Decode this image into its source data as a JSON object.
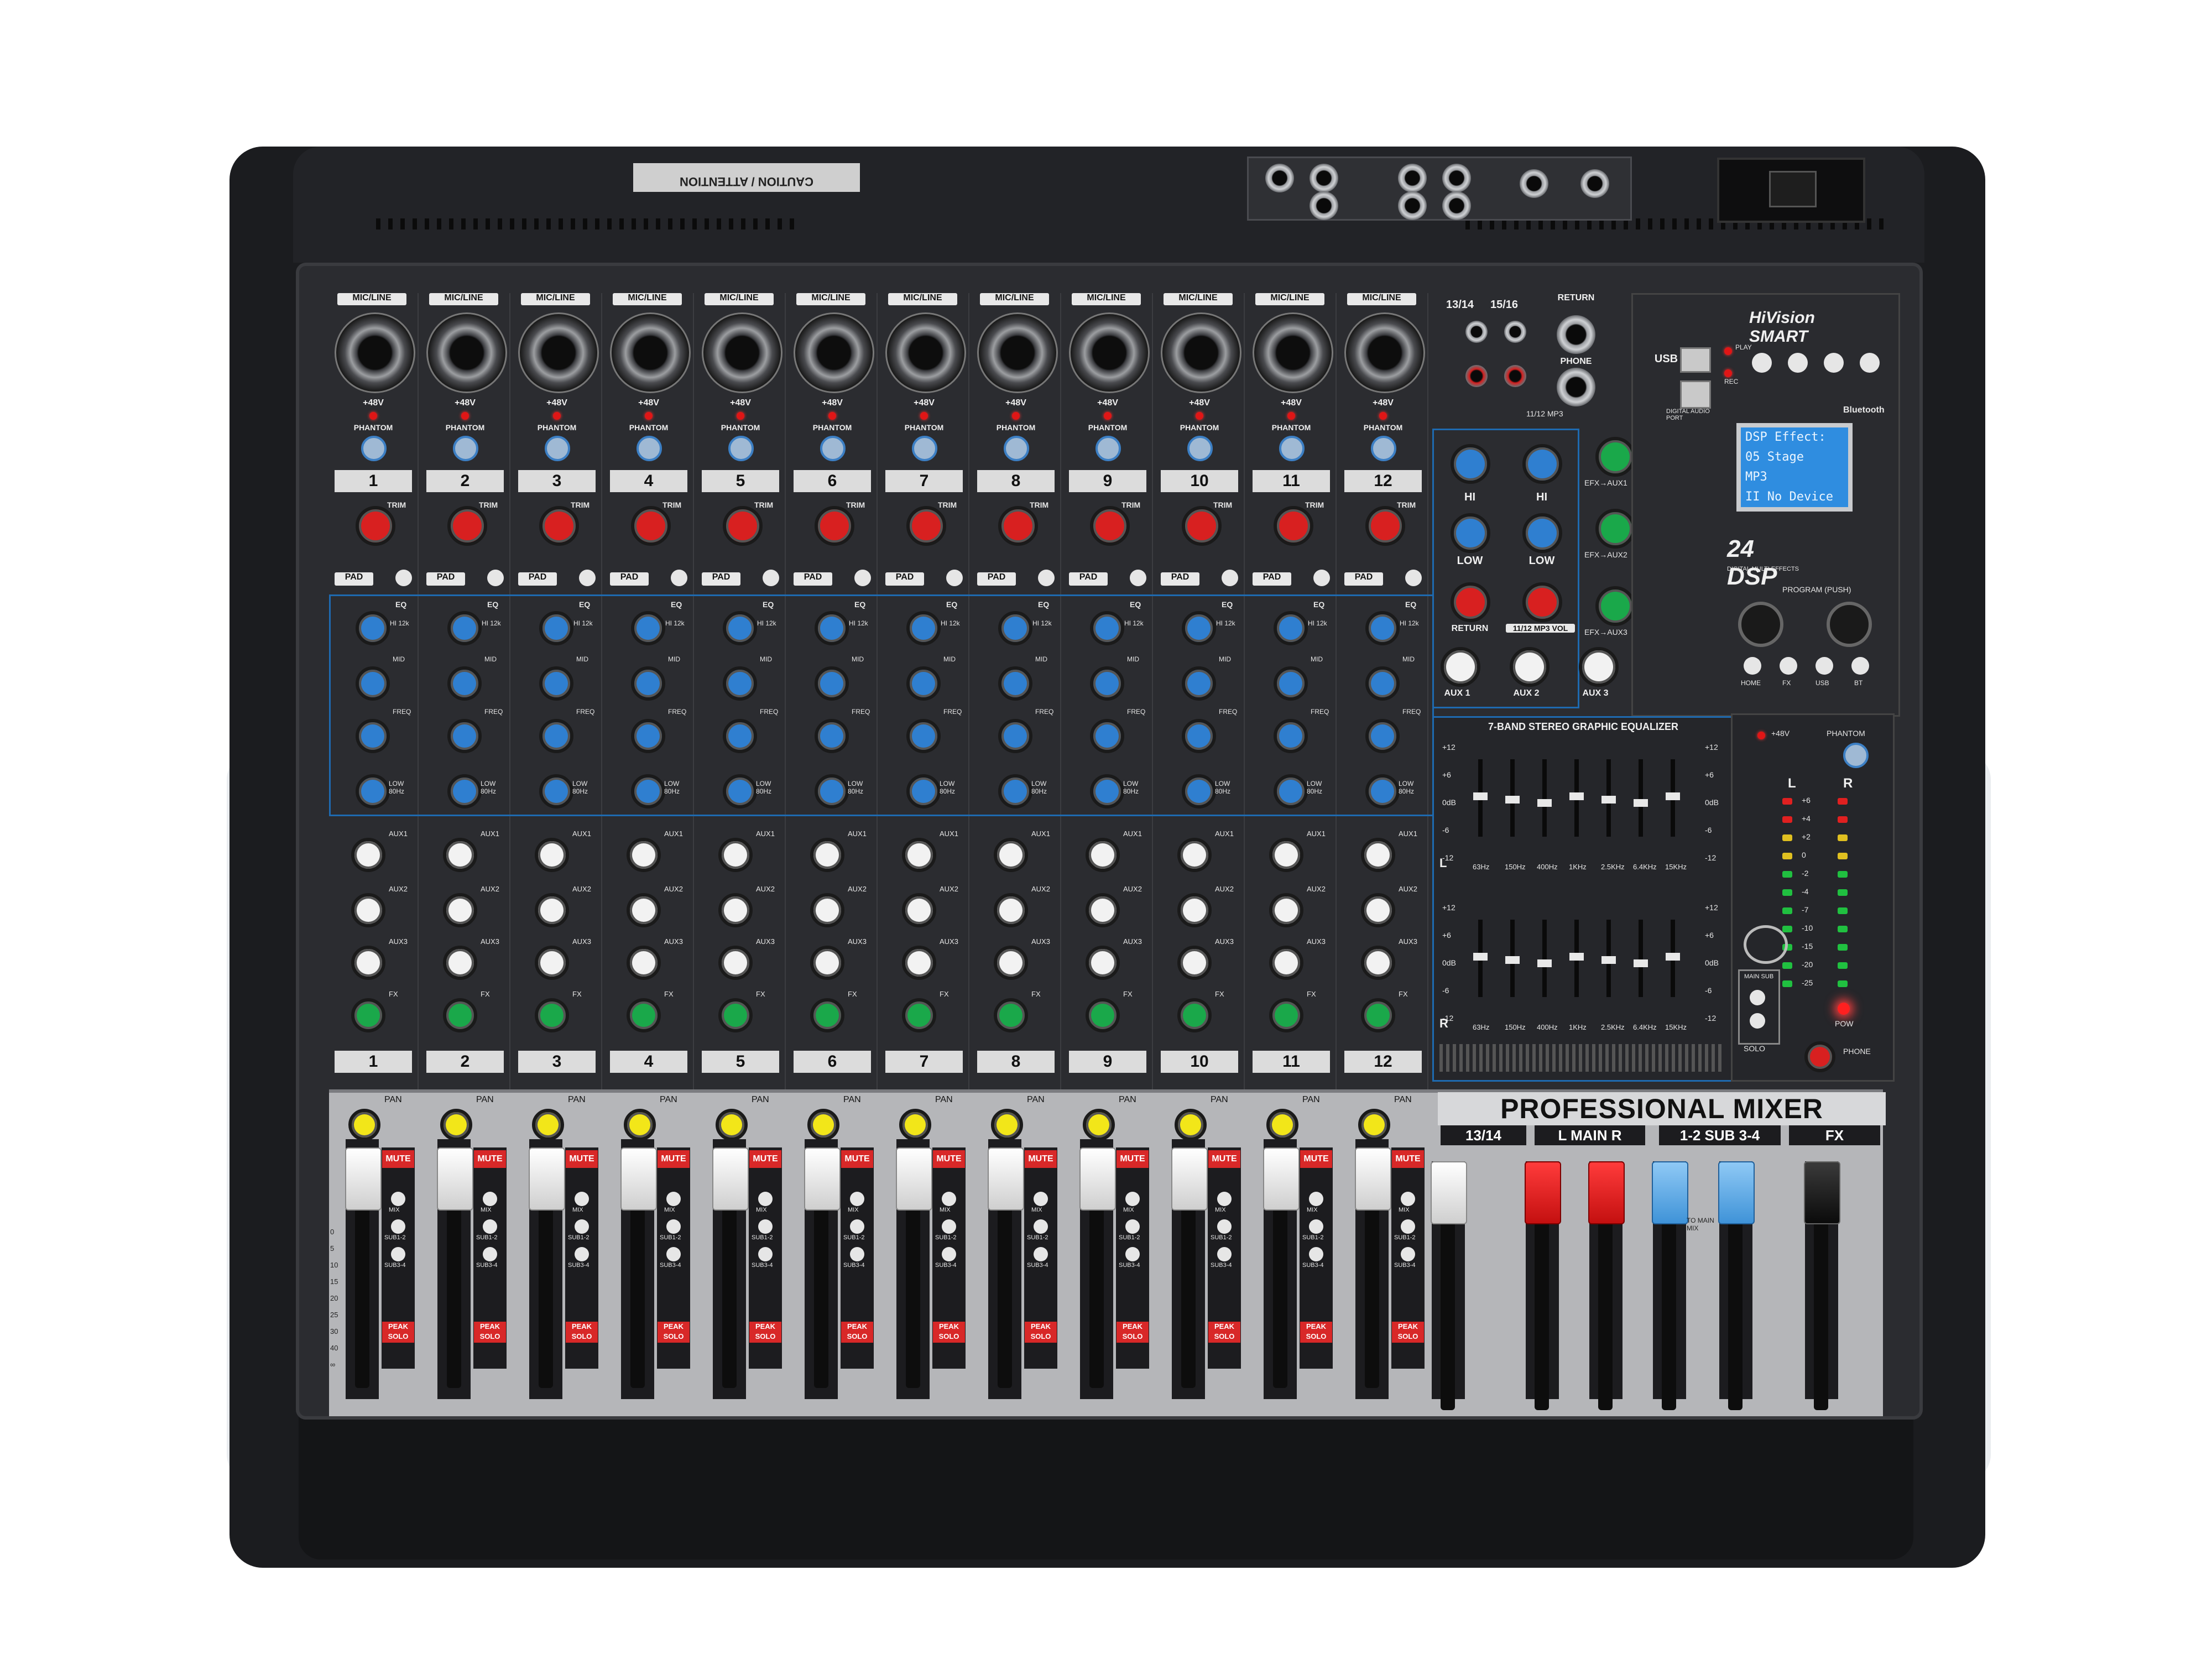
{
  "brand": {
    "logo_text": "HiVision SMART",
    "panel_title": "PROFESSIONAL MIXER"
  },
  "top_panel": {
    "caution_title": "CAUTION",
    "caution_subtitle": "ATTENTION"
  },
  "channels": {
    "count": 12,
    "numbers": [
      "1",
      "2",
      "3",
      "4",
      "5",
      "6",
      "7",
      "8",
      "9",
      "10",
      "11",
      "12"
    ],
    "input_label": "MIC/LINE",
    "phantom_label": "+48V",
    "phantom_button": "PHANTOM",
    "trim_label": "TRIM",
    "pad_label": "PAD",
    "eq_label": "EQ",
    "eq_hi": "HI 12k",
    "eq_mid": "MID",
    "eq_freq": "FREQ",
    "eq_low": "LOW 80Hz",
    "aux_labels": [
      "AUX1",
      "AUX2",
      "AUX3",
      "FX"
    ],
    "pan_label": "PAN",
    "mute_label": "MUTE",
    "mix_label": "MIX",
    "sub12_label": "SUB1-2",
    "sub34_label": "SUB3-4",
    "peak_solo_label": "PEAK SOLO"
  },
  "stereo_inputs": {
    "labels": [
      "13/14",
      "15/16"
    ],
    "return_label": "RETURN",
    "phone_label": "PHONE",
    "mp3_label": "11/12 MP3",
    "hi_label": "HI",
    "low_label": "LOW",
    "return_knob": "RETURN",
    "mp3_vol": "11/12 MP3 VOL",
    "efx_aux1": "EFX→AUX1",
    "efx_aux2": "EFX→AUX2",
    "efx_aux3": "EFX→AUX3",
    "aux_masters": [
      "AUX 1",
      "AUX 2",
      "AUX 3"
    ],
    "fx_master": "FX"
  },
  "media": {
    "usb_label": "USB",
    "play_label": "PLAY",
    "rec_label": "REC",
    "digital_port": "DIGITAL AUDIO PORT",
    "bluetooth": "Bluetooth",
    "lcd_lines": [
      "DSP Effect:",
      "05 Stage",
      "MP3",
      "II No Device"
    ],
    "dsp_badge": "24 DSP",
    "dsp_sub": "DIGITAL MULTI EFFECTS",
    "program_label": "PROGRAM (PUSH)",
    "buttons": [
      "HOME",
      "FX",
      "USB",
      "BT"
    ]
  },
  "graphic_eq": {
    "title": "7-BAND STEREO GRAPHIC EQUALIZER",
    "bands": [
      "63Hz",
      "150Hz",
      "400Hz",
      "1KHz",
      "2.5KHz",
      "6.4KHz",
      "15KHz"
    ],
    "scale": [
      "+12",
      "+6",
      "0dB",
      "-6",
      "-12"
    ],
    "left_label": "L",
    "right_label": "R"
  },
  "master": {
    "phantom_label": "+48V",
    "phantom_button": "PHANTOM",
    "meter_scale": [
      "+6",
      "+4",
      "+2",
      "0",
      "-2",
      "-4",
      "-7",
      "-10",
      "-15",
      "-20",
      "-25"
    ],
    "left": "L",
    "right": "R",
    "solo": "SOLO",
    "power": "POW",
    "phone": "PHONE",
    "main_sub": "MAIN SUB"
  },
  "bus_sections": {
    "stereo_1314": "13/14",
    "main": "L  MAIN  R",
    "sub": "1-2 SUB 3-4",
    "fx": "FX",
    "to_main_mix": "TO MAIN MIX"
  },
  "fader_scale": [
    "0",
    "5",
    "10",
    "15",
    "20",
    "25",
    "30",
    "40",
    "∞"
  ],
  "colors": {
    "knob_red": "#d82020",
    "knob_blue": "#2f7fd0",
    "knob_green": "#1aa84a",
    "knob_yellow": "#f2e619",
    "accent_blue": "#1e6ab0",
    "lcd_blue": "#2f8de0"
  }
}
